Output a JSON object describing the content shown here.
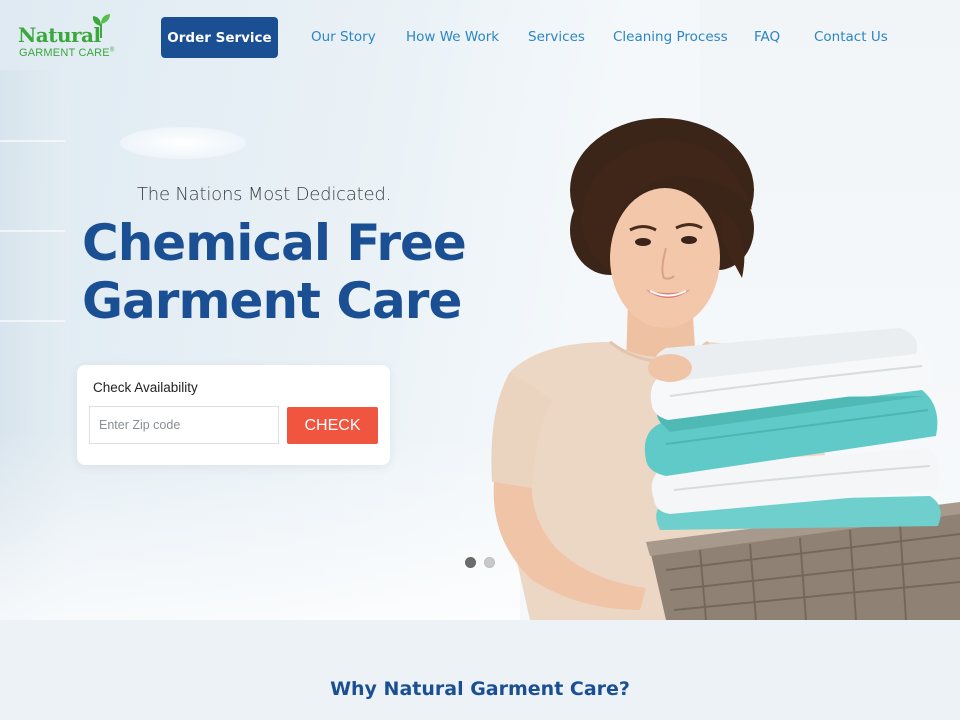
{
  "brand": {
    "logo_word": "Natural",
    "logo_sub": "GARMENT CARE",
    "logo_mark": "®",
    "logo_color": "#3aa83c",
    "leaf_icon": "leaf-icon"
  },
  "nav": {
    "order_button": "Order Service",
    "links": [
      "Our Story",
      "How We Work",
      "Services",
      "Cleaning Process",
      "FAQ",
      "Contact Us"
    ],
    "link_color": "#2b86c5",
    "button_color": "#1b4f94"
  },
  "hero": {
    "tagline": "The Nations Most Dedicated.",
    "headline_line1": "Chemical Free",
    "headline_line2": "Garment Care",
    "headline_color": "#1b4f94"
  },
  "availability": {
    "title": "Check Availability",
    "zip_placeholder": "Enter Zip code",
    "zip_value": "",
    "check_button": "CHECK",
    "button_color": "#f0553f"
  },
  "slider": {
    "slides": 2,
    "active_index": 0,
    "active_color": "#6b6b6b",
    "inactive_color": "#c9c9c9"
  },
  "why_section": {
    "title": "Why Natural Garment Care?"
  }
}
